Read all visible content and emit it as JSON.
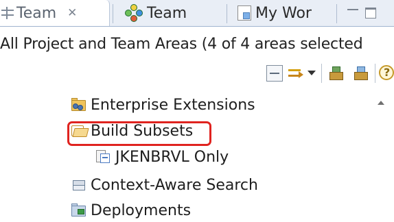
{
  "tabs": [
    {
      "label": "Team",
      "icon": "team-artifacts-icon",
      "active": true,
      "close_glyph": "✕"
    },
    {
      "label": "Team",
      "icon": "team-connect-icon",
      "active": false
    },
    {
      "label": "My Wor",
      "icon": "my-work-icon",
      "active": false
    }
  ],
  "scope": {
    "text": "All Project and Team Areas (4 of 4 areas selected"
  },
  "toolbar": {
    "icons": [
      "collapse-all-icon",
      "link-with-editor-icon",
      "view-menu-icon",
      "build-icon",
      "build-definition-icon",
      "help-icon"
    ]
  },
  "tree": {
    "items": [
      {
        "label": "Enterprise Extensions",
        "icon": "enterprise-folder-icon"
      },
      {
        "label": "Build Subsets",
        "icon": "open-folder-icon",
        "highlighted": true
      },
      {
        "label": "JKENBRVL Only",
        "icon": "build-subset-icon"
      },
      {
        "label": "Context-Aware Search",
        "icon": "search-stack-icon"
      },
      {
        "label": "Deployments",
        "icon": "deployment-folder-icon"
      }
    ]
  },
  "colors": {
    "highlight": "#e0231f",
    "tab_strip": "#e9eef6"
  }
}
